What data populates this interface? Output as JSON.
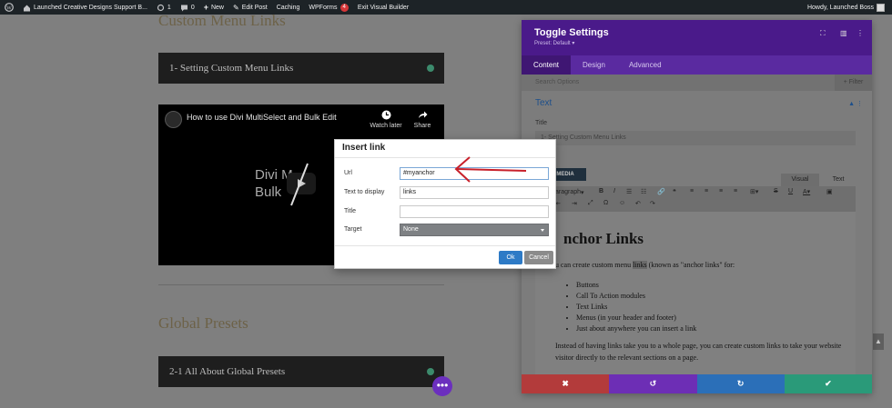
{
  "adminbar": {
    "site": "Launched Creative Designs Support B...",
    "updates": "1",
    "comments": "0",
    "new": "New",
    "edit": "Edit Post",
    "caching": "Caching",
    "wpforms": "WPForms",
    "wpforms_count": "4",
    "exit": "Exit Visual Builder",
    "howdy": "Howdy, Launched Boss"
  },
  "page": {
    "heading1": "Custom Menu Links",
    "toggle1": "1- Setting Custom Menu Links",
    "video": {
      "title": "How to use Divi MultiSelect and Bulk Edit",
      "watch_later": "Watch later",
      "share": "Share",
      "center_line1": "Divi M",
      "center_line2": "Bulk"
    },
    "heading2": "Global Presets",
    "toggle2": "2-1 All About Global Presets",
    "more": "•••"
  },
  "panel": {
    "title": "Toggle Settings",
    "preset": "Preset: Default ▾",
    "tabs": [
      "Content",
      "Design",
      "Advanced"
    ],
    "active_tab": "Content",
    "search_placeholder": "Search Options",
    "filter": "+ Filter",
    "section": "Text",
    "title_label": "Title",
    "title_value": "1- Setting Custom Menu Links",
    "add_media": "MEDIA",
    "visual_tab": "Visual",
    "text_tab": "Text",
    "paragraph": "aragraph",
    "editor": {
      "heading": "nchor Links",
      "intro_before": "u can create custom menu ",
      "intro_highlight": "links",
      "intro_after": " (known as \"anchor links\" for:",
      "items": [
        "Buttons",
        "Call To Action modules",
        "Text Links",
        "Menus (in your header and footer)",
        "Just about anywhere you can insert a link"
      ],
      "para": "Instead of having links take you to a whole page, you can create custom links to take your website visitor directly to the relevant sections on a page."
    },
    "footer": [
      "✖",
      "↺",
      "↻",
      "✔"
    ]
  },
  "dialog": {
    "title": "Insert link",
    "url_label": "Url",
    "url_value": "#myanchor",
    "display_label": "Text to display",
    "display_value": "links",
    "title_label": "Title",
    "title_value": "",
    "target_label": "Target",
    "target_value": "None",
    "ok": "Ok",
    "cancel": "Cancel"
  },
  "colors": {
    "admin": "#1d2327",
    "panel_header": "#4a1a8a",
    "footer_red": "#b33b3b",
    "footer_purple": "#6d2eb5",
    "footer_blue": "#2b6fb8",
    "footer_green": "#2a9a79",
    "arrow": "#c8202a",
    "ok": "#2d7ac6"
  },
  "icons": [
    "wordpress-icon",
    "home-icon",
    "refresh-icon",
    "comment-icon",
    "plus-icon",
    "clock-icon",
    "share-icon",
    "expand-icon",
    "split-icon",
    "more-icon",
    "chevron-up-icon",
    "close-icon",
    "undo-icon",
    "redo-icon",
    "check-icon"
  ]
}
